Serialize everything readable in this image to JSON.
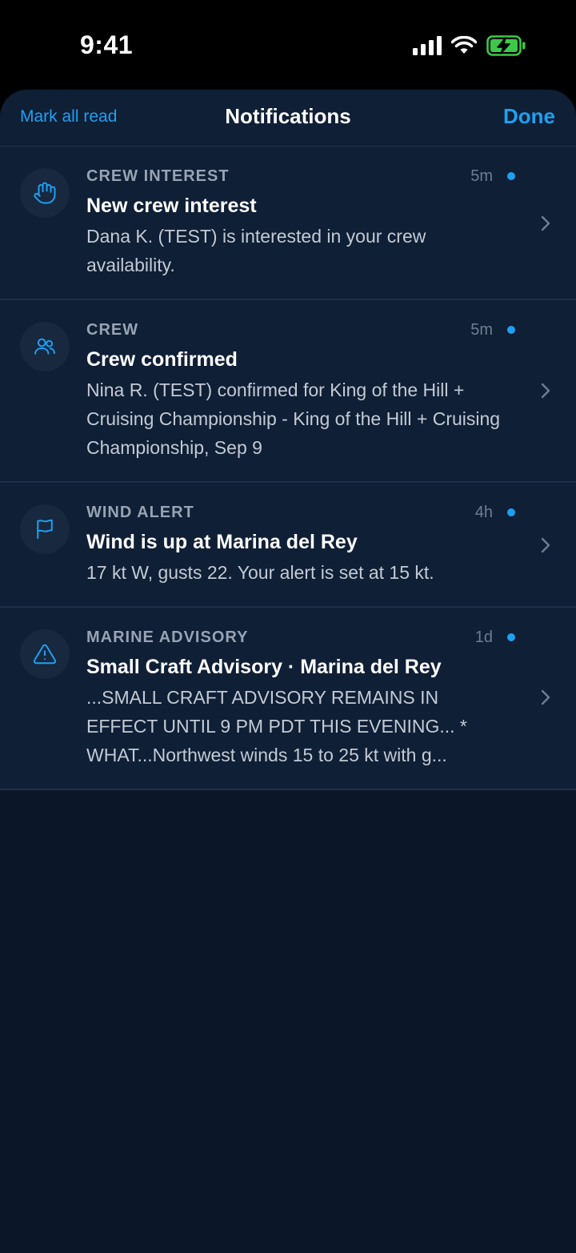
{
  "status_bar": {
    "time": "9:41"
  },
  "nav": {
    "left_action": "Mark all read",
    "title": "Notifications",
    "right_action": "Done"
  },
  "notifications": [
    {
      "category": "CREW INTEREST",
      "title": "New crew interest",
      "body": "Dana K. (TEST) is interested in your crew availability.",
      "time": "5m",
      "unread": true,
      "icon": "hand-icon"
    },
    {
      "category": "CREW",
      "title": "Crew confirmed",
      "body": "Nina R. (TEST) confirmed for King of the Hill + Cruising Championship - King of the Hill + Cruising Championship, Sep 9",
      "time": "5m",
      "unread": true,
      "icon": "people-icon"
    },
    {
      "category": "WIND ALERT",
      "title": "Wind is up at Marina del Rey",
      "body": "17 kt W, gusts 22. Your alert is set at 15 kt.",
      "time": "4h",
      "unread": true,
      "icon": "flag-icon"
    },
    {
      "category": "MARINE ADVISORY",
      "title": "Small Craft Advisory · Marina del Rey",
      "body": "...SMALL CRAFT ADVISORY REMAINS IN EFFECT UNTIL 9 PM PDT THIS EVENING... * WHAT...Northwest winds 15 to 25 kt with g...",
      "time": "1d",
      "unread": true,
      "icon": "warning-icon"
    }
  ],
  "colors": {
    "accent": "#1ea0f2",
    "background": "#0b1628",
    "card": "#0f1f35"
  }
}
